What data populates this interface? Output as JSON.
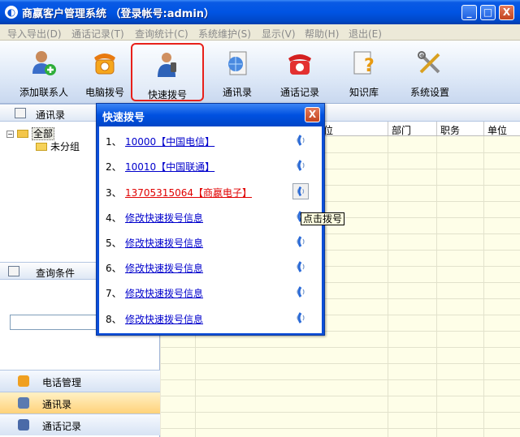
{
  "window": {
    "title": "商嬴客户管理系统 （登录帐号:admin）",
    "controls": {
      "minimize": "_",
      "maximize": "□",
      "close": "X"
    }
  },
  "menu": [
    {
      "label": "导入导出(D)"
    },
    {
      "label": "通话记录(T)"
    },
    {
      "label": "查询统计(C)"
    },
    {
      "label": "系统维护(S)"
    },
    {
      "label": "显示(V)"
    },
    {
      "label": "帮助(H)"
    },
    {
      "label": "退出(E)"
    }
  ],
  "toolbar": [
    {
      "label": "添加联系人",
      "icon": "add-contact-icon"
    },
    {
      "label": "电脑拨号",
      "icon": "telephone-icon"
    },
    {
      "label": "快速拨号",
      "icon": "user-phone-icon",
      "highlighted": true
    },
    {
      "label": "通讯录",
      "icon": "address-book-icon"
    },
    {
      "label": "通话记录",
      "icon": "call-record-icon"
    },
    {
      "label": "知识库",
      "icon": "knowledge-icon"
    },
    {
      "label": "系统设置",
      "icon": "settings-icon"
    }
  ],
  "left_panel": {
    "header": "通讯录",
    "tree": {
      "root": "全部",
      "child": "未分组"
    },
    "query_header": "查询条件",
    "nav": [
      {
        "label": "电话管理",
        "icon": "phone-manage-icon"
      },
      {
        "label": "通讯录",
        "icon": "address-book-icon",
        "active": true
      },
      {
        "label": "通话记录",
        "icon": "call-record-icon"
      }
    ]
  },
  "grid": {
    "columns": [
      "位",
      "部门",
      "职务",
      "单位"
    ]
  },
  "dialog": {
    "title": "快速拨号",
    "close": "X",
    "entries": [
      {
        "num": "1、",
        "text": "10000【中国电信】",
        "color": "blue"
      },
      {
        "num": "2、",
        "text": "10010【中国联通】",
        "color": "blue"
      },
      {
        "num": "3、",
        "text": "13705315064【商嬴电子】",
        "color": "red"
      },
      {
        "num": "4、",
        "text": "修改快速拨号信息",
        "color": "blue"
      },
      {
        "num": "5、",
        "text": "修改快速拨号信息",
        "color": "blue"
      },
      {
        "num": "6、",
        "text": "修改快速拨号信息",
        "color": "blue"
      },
      {
        "num": "7、",
        "text": "修改快速拨号信息",
        "color": "blue"
      },
      {
        "num": "8、",
        "text": "修改快速拨号信息",
        "color": "blue"
      }
    ],
    "tooltip": "点击拨号"
  },
  "colors": {
    "titlebar": "#0054e3",
    "highlight_border": "#e8201a",
    "link": "#0000cc",
    "link_active": "#e00000"
  }
}
